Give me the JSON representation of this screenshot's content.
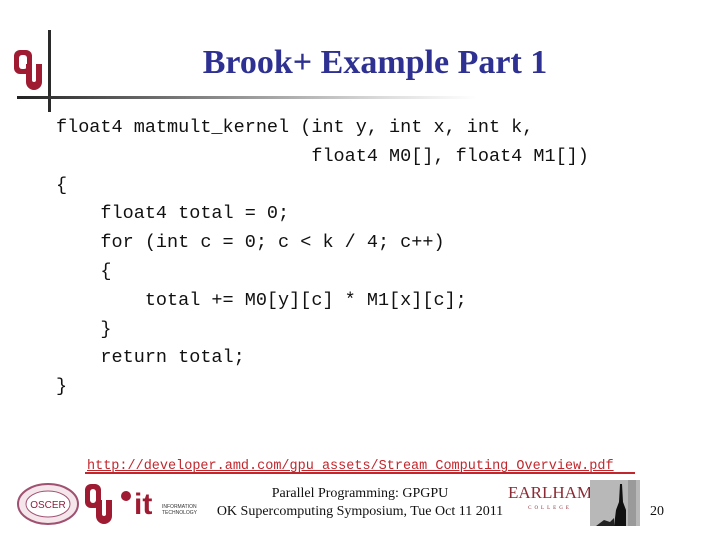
{
  "slide": {
    "title": "Brook+ Example Part 1",
    "code_lines": [
      "float4 matmult_kernel (int y, int x, int k,",
      "                       float4 M0[], float4 M1[])",
      "{",
      "    float4 total = 0;",
      "    for (int c = 0; c < k / 4; c++)",
      "    {",
      "        total += M0[y][c] * M1[x][c];",
      "    }",
      "    return total;",
      "}"
    ],
    "reference_url": "http://developer.amd.com/gpu_assets/Stream_Computing_Overview.pdf"
  },
  "footer": {
    "line1": "Parallel Programming: GPGPU",
    "line2": "OK Supercomputing Symposium, Tue Oct 11 2011",
    "page_number": "20",
    "logos": {
      "oscer": "OSCER",
      "it_main": "it",
      "it_sub1": "INFORMATION",
      "it_sub2": "TECHNOLOGY",
      "earlham_main": "EARLHAM",
      "earlham_sub": "COLLEGE"
    }
  },
  "colors": {
    "title": "#2e3192",
    "ou_crimson": "#9e1b32",
    "link": "#c0272d"
  }
}
